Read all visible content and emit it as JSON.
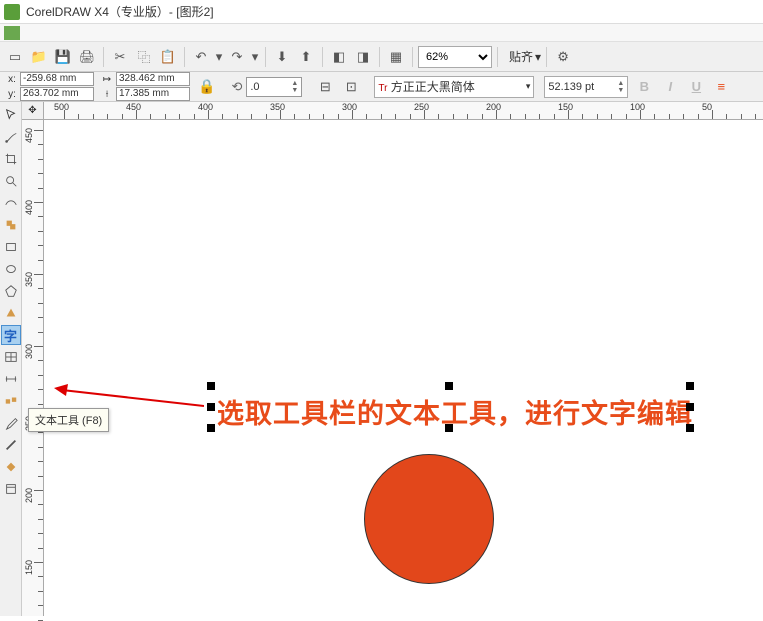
{
  "titlebar": {
    "title": "CorelDRAW X4（专业版）- [图形2]"
  },
  "toolbar": {
    "zoom": "62%",
    "snap_label": "贴齐"
  },
  "props": {
    "x_label": "x:",
    "y_label": "y:",
    "x": "-259.68 mm",
    "y": "263.702 mm",
    "w": "328.462 mm",
    "h": "17.385 mm",
    "rotation": ".0",
    "font": "方正正大黑简体",
    "font_marker": "Tr",
    "fontsize": "52.139 pt",
    "B": "B",
    "I": "I",
    "U": "U"
  },
  "ruler_h": {
    "labels": [
      "-500",
      "-450",
      "-400",
      "-350",
      "-300",
      "-250",
      "-200",
      "-150",
      "-100",
      "-50"
    ],
    "start": -500,
    "step": 50
  },
  "ruler_v": {
    "labels": [
      "450",
      "400",
      "350",
      "300",
      "250",
      "200",
      "150"
    ],
    "start": 450,
    "step": -50
  },
  "canvas": {
    "big_text": "选取工具栏的文本工具，进行文字编辑"
  },
  "tooltip": {
    "text": "文本工具 (F8)"
  },
  "tools": {
    "text_char": "字"
  },
  "ruler_corner": "✥"
}
